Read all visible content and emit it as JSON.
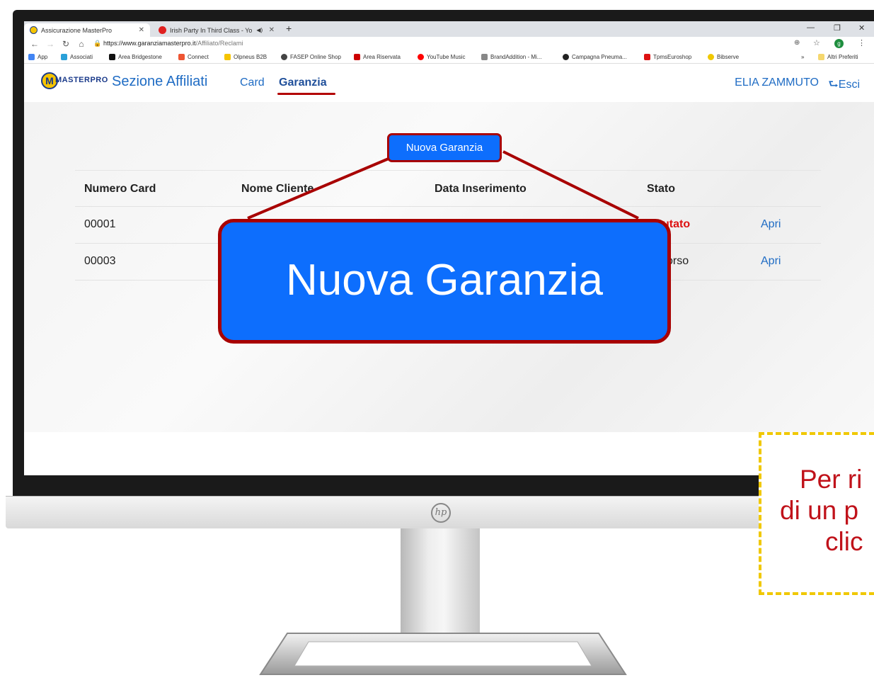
{
  "browser": {
    "tabs": [
      {
        "label": "Assicurazione MasterPro",
        "active": true
      },
      {
        "label": "Irish Party In Third Class - Yo",
        "active": false
      }
    ],
    "url_host": "https://www.garanziamasterpro.it",
    "url_path": "/Affiliato/Reclami",
    "bookmarks": [
      "App",
      "Associati",
      "Area Bridgestone",
      "Connect",
      "Olpneus B2B",
      "FASEP Online Shop",
      "Area Riservata",
      "YouTube Music",
      "BrandAddition - Mi...",
      "Campagna Pneuma...",
      "TpmsEuroshop",
      "Bibserve"
    ],
    "more_bookmarks": "Altri Preferiti",
    "profile_initial": "g"
  },
  "site": {
    "logo_text": "MASTERPRO",
    "logo_letter": "M",
    "brand": "Sezione Affiliati",
    "nav": {
      "card": "Card",
      "garanzia": "Garanzia"
    },
    "user": "ELIA ZAMMUTO",
    "logout": "Esci",
    "new_button": "Nuova Garanzia",
    "table": {
      "headers": [
        "Numero Card",
        "Nome Cliente",
        "Data Inserimento",
        "Stato"
      ],
      "rows": [
        {
          "numero": "00001",
          "stato": "utato",
          "action": "Apri"
        },
        {
          "numero": "00003",
          "stato": "orso",
          "action": "Apri"
        }
      ]
    }
  },
  "callout": {
    "zoom_label": "Nuova Garanzia",
    "tip_lines": [
      "Per ri",
      "di un p",
      "clic"
    ]
  },
  "colors": {
    "accent": "#0d6efd",
    "highlight_border": "#a80000",
    "tip_border": "#f0c800",
    "tip_text": "#c0121a"
  }
}
